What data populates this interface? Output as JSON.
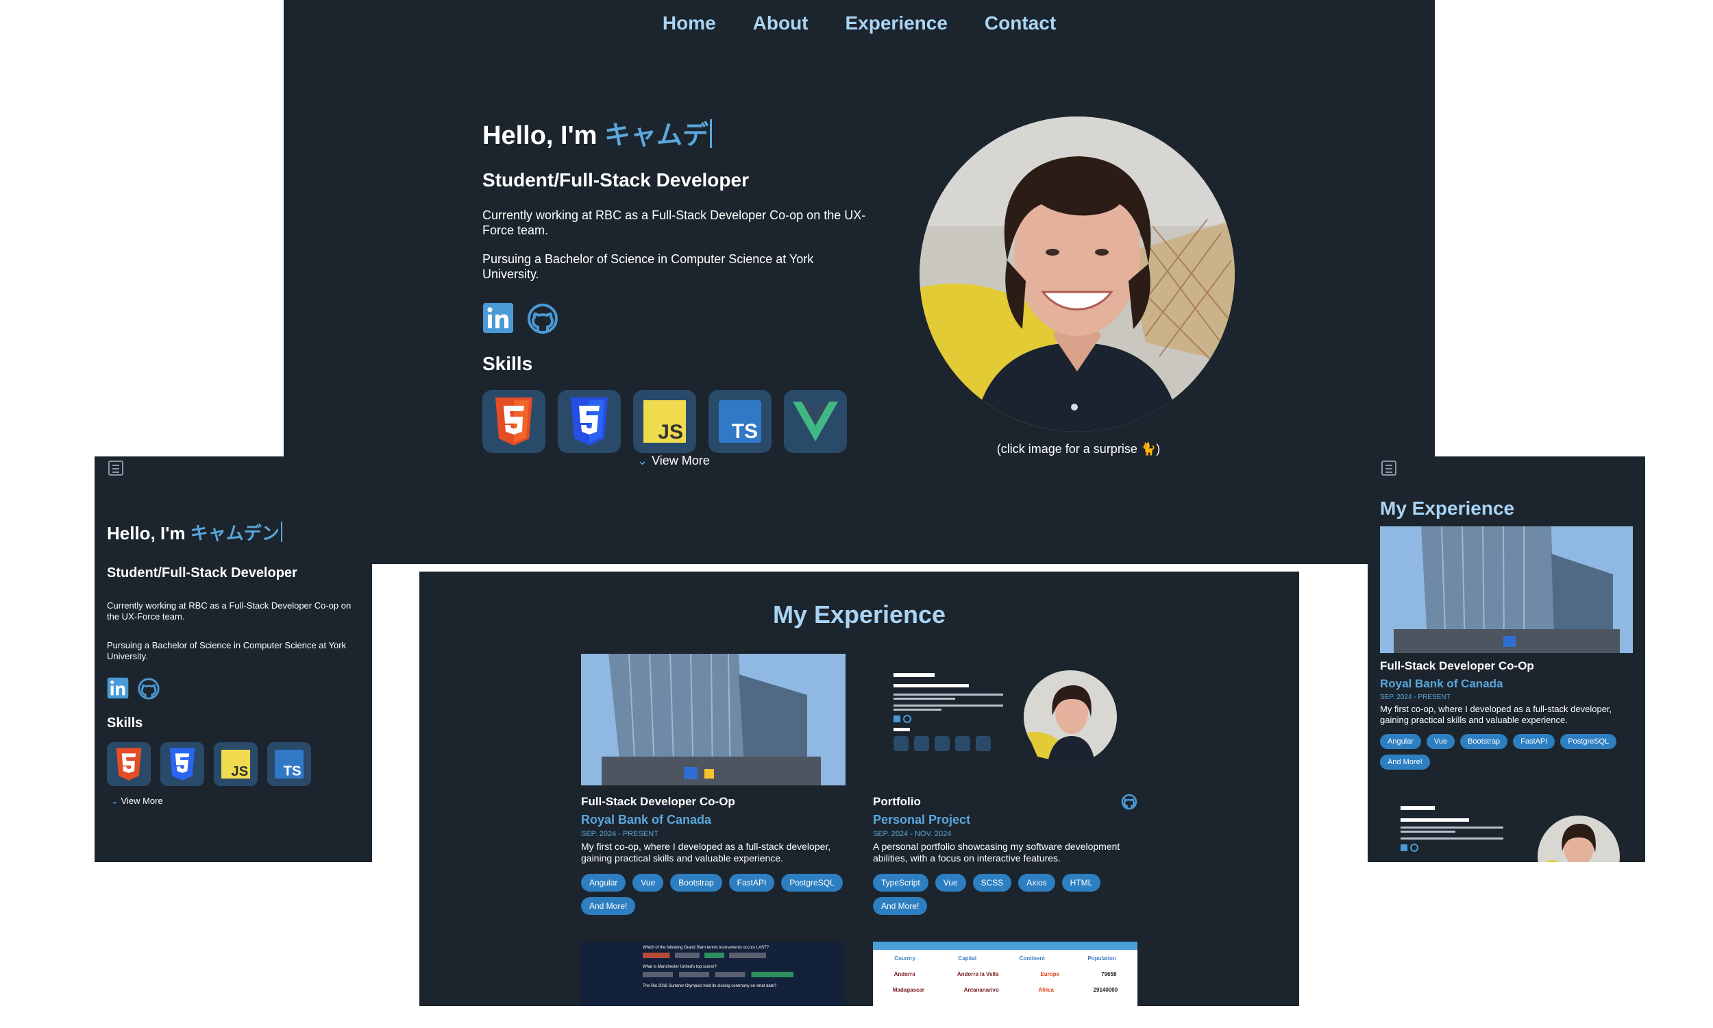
{
  "colors": {
    "background": "#1c252d",
    "accent": "#5aa7dd",
    "nav_text": "#a9d4f5",
    "tag_bg": "#2d7fc1"
  },
  "nav": {
    "items": [
      "Home",
      "About",
      "Experience",
      "Contact"
    ]
  },
  "hero": {
    "greeting": "Hello, I'm",
    "name_typed": "キャムデ",
    "role": "Student/Full-Stack Developer",
    "line1": "Currently working at RBC as a Full-Stack Developer Co-op on the UX-Force team.",
    "line2": "Pursuing a Bachelor of Science in Computer Science at York University.",
    "social_icons": [
      "linkedin-icon",
      "github-icon"
    ],
    "skills_title": "Skills",
    "skills": [
      "HTML5",
      "CSS3",
      "JavaScript",
      "TypeScript",
      "Vue"
    ],
    "view_more": "View More",
    "image_caption": "(click image for a surprise 🐈)"
  },
  "mobile_hero": {
    "name_typed": "キャムデン",
    "skills_visible": [
      "HTML5",
      "CSS3",
      "JavaScript",
      "TypeScript"
    ]
  },
  "experience": {
    "title": "My Experience",
    "cards": [
      {
        "title": "Full-Stack Developer Co-Op",
        "company": "Royal Bank of Canada",
        "date": "SEP. 2024 - PRESENT",
        "description": "My first co-op, where I developed as a full-stack developer, gaining practical skills and valuable experience.",
        "tags": [
          "Angular",
          "Vue",
          "Bootstrap",
          "FastAPI",
          "PostgreSQL",
          "And More!"
        ]
      },
      {
        "title": "Portfolio",
        "company": "Personal Project",
        "date": "SEP. 2024 - NOV. 2024",
        "description": "A personal portfolio showcasing my software development abilities, with a focus on interactive features.",
        "tags": [
          "TypeScript",
          "Vue",
          "SCSS",
          "Axios",
          "HTML",
          "And More!"
        ]
      }
    ],
    "preview_trivia": [
      "Which of the following Grand Slam tennis tournaments occurs LAST?",
      "What is Manchester United's top scorer?",
      "The Rio 2016 Summer Olympics held its closing ceremony on what date?"
    ],
    "preview_table": {
      "headers": [
        "Country",
        "Capital",
        "Continent",
        "Population"
      ],
      "rows": [
        [
          "Andorra",
          "Andorra la Vella",
          "Europe",
          "79658"
        ],
        [
          "Madagascar",
          "Antananarivo",
          "Africa",
          "29140000"
        ]
      ]
    }
  }
}
